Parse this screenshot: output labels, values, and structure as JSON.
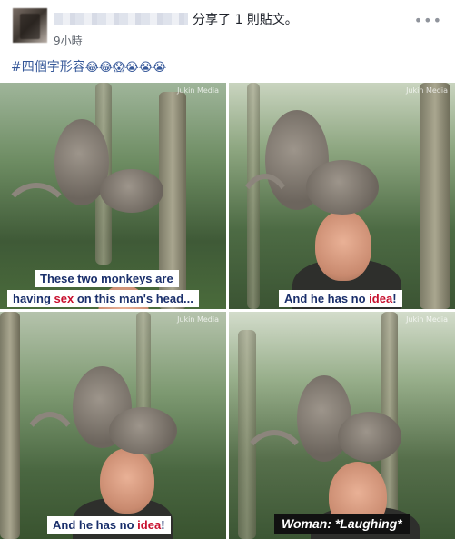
{
  "post": {
    "shared_text": "分享了 1 則貼文。",
    "timestamp": "9小時",
    "menu_icon": "more-horizontal-icon",
    "hashtag": "#四個字形容",
    "emojis": "😂😂😱😭😭😭"
  },
  "panels": [
    {
      "watermark": "Jukin Media",
      "caption_line1": "These two monkeys are",
      "caption_line2_pre": "having ",
      "caption_line2_hl": "sex",
      "caption_line2_post": " on this man's head..."
    },
    {
      "watermark": "Jukin Media",
      "caption_pre": "And he has no ",
      "caption_hl": "idea",
      "caption_post": "!"
    },
    {
      "watermark": "Jukin Media",
      "caption_pre": "And he has no ",
      "caption_hl": "idea",
      "caption_post": "!"
    },
    {
      "watermark": "Jukin Media",
      "caption": "Woman: *Laughing*"
    }
  ],
  "colors": {
    "link": "#365899",
    "caption_text": "#1a2f6b",
    "caption_highlight": "#c8102e"
  }
}
